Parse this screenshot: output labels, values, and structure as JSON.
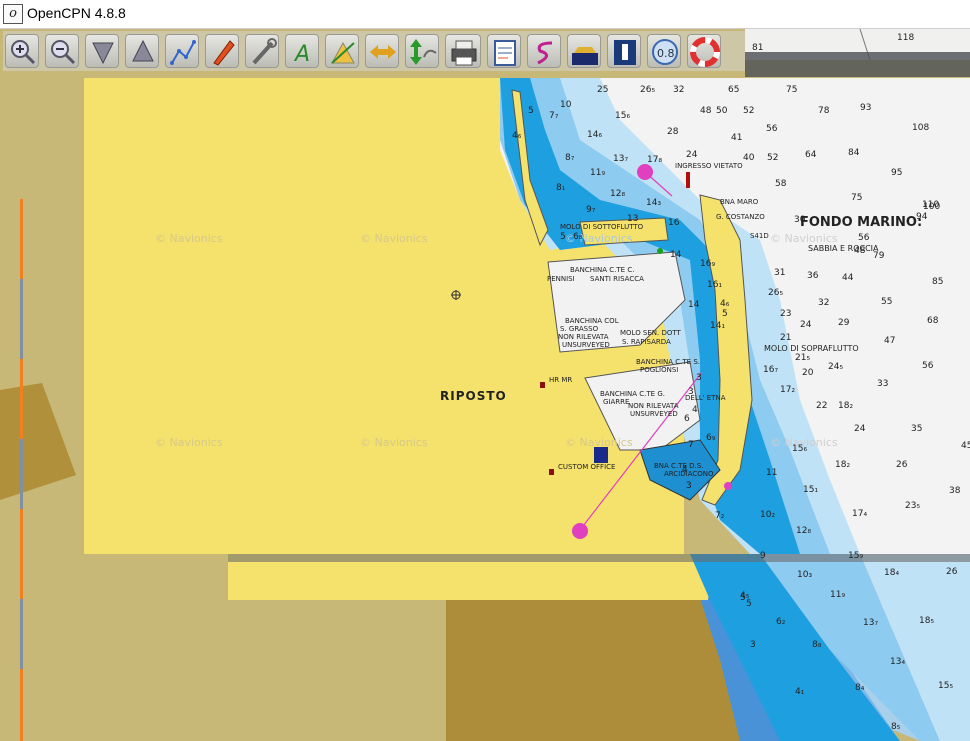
{
  "window": {
    "title": "OpenCPN 4.8.8",
    "app_icon": "opencpn-app-icon"
  },
  "toolbar": {
    "buttons": [
      {
        "name": "zoom-in-button",
        "icon": "zoom-in-icon"
      },
      {
        "name": "zoom-out-button",
        "icon": "zoom-out-icon"
      },
      {
        "name": "scale-down-button",
        "icon": "scale-down-icon"
      },
      {
        "name": "scale-up-button",
        "icon": "scale-up-icon"
      },
      {
        "name": "create-route-button",
        "icon": "route-icon"
      },
      {
        "name": "auto-follow-button",
        "icon": "ship-icon"
      },
      {
        "name": "settings-button",
        "icon": "wrench-icon"
      },
      {
        "name": "text-button",
        "icon": "text-a-icon"
      },
      {
        "name": "current-tide-button",
        "icon": "tide-icon"
      },
      {
        "name": "cm93-zoom-button",
        "icon": "horizontal-arrows-icon"
      },
      {
        "name": "tide-curve-button",
        "icon": "vertical-arrows-icon"
      },
      {
        "name": "print-button",
        "icon": "printer-icon"
      },
      {
        "name": "route-manager-button",
        "icon": "clipboard-icon"
      },
      {
        "name": "track-button",
        "icon": "track-s-icon"
      },
      {
        "name": "color-scheme-button",
        "icon": "boat-night-icon"
      },
      {
        "name": "mob-info-button",
        "icon": "info-panel-icon"
      },
      {
        "name": "compass-button",
        "icon": "compass-icon"
      },
      {
        "name": "mob-button",
        "icon": "lifebuoy-icon"
      }
    ],
    "compass_value": "0.8"
  },
  "chart": {
    "watermark": "© Navionics",
    "labels": {
      "riposto": "RIPOSTO",
      "fondo_marino": "FONDO MARINO:",
      "sabbia": "SABBIA E ROCCIA",
      "ingresso": "INGRESSO VIETATO",
      "bna_maro": "BNA MARO",
      "g_costanzo": "G. COSTANZO",
      "molo_sottoflutto": "MOLO DI SOTTOFLUTTO",
      "banchina_cte": "BANCHINA C.TE C.",
      "pennisi": "PENNISI",
      "santi_risacca": "SANTI RISACCA",
      "banchina_col": "BANCHINA COL",
      "s_grasso": "S. GRASSO",
      "non_rilevata": "NON RILEVATA",
      "unsurveyed": "UNSURVEYED",
      "molo_sen": "MOLO SEN. DOTT",
      "s_rapisarda": "S. RAPISARDA",
      "banchina_cte_s": "BANCHINA C.TE S.",
      "poglionsi": "POGLIONSI",
      "molo_sopraflutto": "MOLO DI SOPRAFLUTTO",
      "hr_mr": "HR MR",
      "custom_office": "CUSTOM OFFICE",
      "banchina_giarre": "BANCHINA C.TE G.",
      "giarre": "GIARRE",
      "dell_etna": "DELL' ETNA",
      "non_rilevata2": "NON RILEVATA",
      "unsurveyed2": "UNSURVEYED",
      "bna_cte_d": "BNA C.TE D.S.",
      "arcidiacono": "ARCIDIACONO",
      "s41d": "S41D"
    },
    "soundings": [
      {
        "v": "118"
      },
      {
        "v": "81"
      },
      {
        "v": "25"
      },
      {
        "v": "26₅"
      },
      {
        "v": "32"
      },
      {
        "v": "65"
      },
      {
        "v": "75"
      },
      {
        "v": "5"
      },
      {
        "v": "7₇"
      },
      {
        "v": "10"
      },
      {
        "v": "48"
      },
      {
        "v": "50"
      },
      {
        "v": "52"
      },
      {
        "v": "78"
      },
      {
        "v": "93"
      },
      {
        "v": "108"
      },
      {
        "v": "4₆"
      },
      {
        "v": "15₆"
      },
      {
        "v": "28"
      },
      {
        "v": "41"
      },
      {
        "v": "56"
      },
      {
        "v": "14₆"
      },
      {
        "v": "8₇"
      },
      {
        "v": "13₇"
      },
      {
        "v": "17₈"
      },
      {
        "v": "24"
      },
      {
        "v": "40"
      },
      {
        "v": "52"
      },
      {
        "v": "64"
      },
      {
        "v": "84"
      },
      {
        "v": "95"
      },
      {
        "v": "110"
      },
      {
        "v": "11₉"
      },
      {
        "v": "8₁"
      },
      {
        "v": "12₈"
      },
      {
        "v": "14₃"
      },
      {
        "v": "58"
      },
      {
        "v": "75"
      },
      {
        "v": "100"
      },
      {
        "v": "94"
      },
      {
        "v": "9₇"
      },
      {
        "v": "13"
      },
      {
        "v": "5"
      },
      {
        "v": "6₈"
      },
      {
        "v": "16"
      },
      {
        "v": "30"
      },
      {
        "v": "56"
      },
      {
        "v": "48"
      },
      {
        "v": "79"
      },
      {
        "v": "14"
      },
      {
        "v": "16₉"
      },
      {
        "v": "31"
      },
      {
        "v": "36"
      },
      {
        "v": "44"
      },
      {
        "v": "85"
      },
      {
        "v": "16₁"
      },
      {
        "v": "26₅"
      },
      {
        "v": "32"
      },
      {
        "v": "55"
      },
      {
        "v": "14"
      },
      {
        "v": "4₆"
      },
      {
        "v": "5"
      },
      {
        "v": "23"
      },
      {
        "v": "14₁"
      },
      {
        "v": "24"
      },
      {
        "v": "29"
      },
      {
        "v": "68"
      },
      {
        "v": "21"
      },
      {
        "v": "47"
      },
      {
        "v": "21₅"
      },
      {
        "v": "16₇"
      },
      {
        "v": "20"
      },
      {
        "v": "24₅"
      },
      {
        "v": "56"
      },
      {
        "v": "17₂"
      },
      {
        "v": "33"
      },
      {
        "v": "3"
      },
      {
        "v": "22"
      },
      {
        "v": "18₂"
      },
      {
        "v": "24"
      },
      {
        "v": "35"
      },
      {
        "v": "4"
      },
      {
        "v": "6₉"
      },
      {
        "v": "15₆"
      },
      {
        "v": "45"
      },
      {
        "v": "26"
      },
      {
        "v": "18₂"
      },
      {
        "v": "3"
      },
      {
        "v": "11"
      },
      {
        "v": "15₁"
      },
      {
        "v": "7₂"
      },
      {
        "v": "10₂"
      },
      {
        "v": "17₄"
      },
      {
        "v": "38"
      },
      {
        "v": "12₈"
      },
      {
        "v": "23₅"
      },
      {
        "v": "9"
      },
      {
        "v": "15₉"
      },
      {
        "v": "10₃"
      },
      {
        "v": "18₄"
      },
      {
        "v": "26"
      },
      {
        "v": "4₅"
      },
      {
        "v": "11₉"
      },
      {
        "v": "5"
      },
      {
        "v": "6₂"
      },
      {
        "v": "8₈"
      },
      {
        "v": "13₇"
      },
      {
        "v": "18₅"
      },
      {
        "v": "3"
      },
      {
        "v": "13₄"
      },
      {
        "v": "4₁"
      },
      {
        "v": "8₄"
      },
      {
        "v": "15₅"
      },
      {
        "v": "8₅"
      },
      {
        "v": "3"
      },
      {
        "v": "7"
      },
      {
        "v": "4"
      },
      {
        "v": "6"
      },
      {
        "v": "5"
      }
    ]
  },
  "colors": {
    "land": "#f5e26c",
    "land_raster": "#c8b878",
    "land_dark": "#b0903a",
    "shallow": "#1ea0e0",
    "mid": "#8ecbf0",
    "deep": "#c0e2f6",
    "deepest": "#f3f3f3",
    "route": "#e040c0",
    "scale_orange": "#f08020",
    "scale_grey": "#8090a0"
  }
}
